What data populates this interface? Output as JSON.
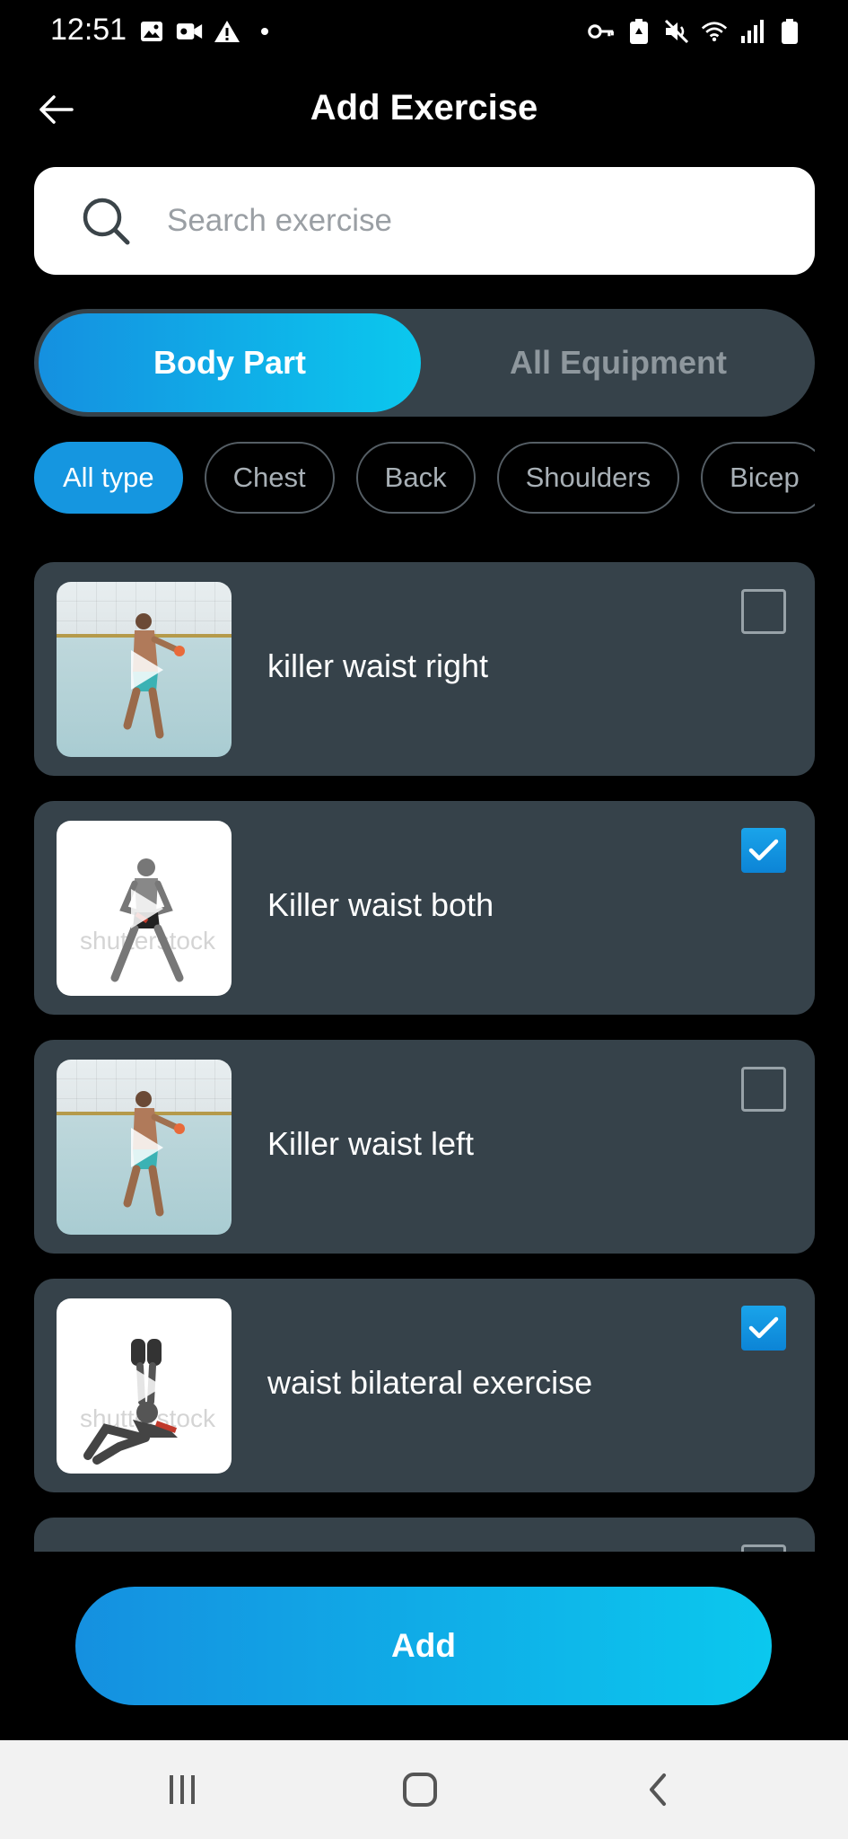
{
  "status_bar": {
    "time": "12:51",
    "left_icons": [
      "gallery-icon",
      "video-icon",
      "warning-icon",
      "dot-icon"
    ],
    "right_icons": [
      "vpn-key-icon",
      "battery-saver-icon",
      "mute-icon",
      "wifi-icon",
      "signal-icon",
      "battery-icon"
    ]
  },
  "header": {
    "title": "Add Exercise",
    "back_icon": "arrow-left-icon"
  },
  "search": {
    "placeholder": "Search exercise",
    "value": "",
    "icon": "search-icon"
  },
  "segment": {
    "options": [
      "Body Part",
      "All Equipment"
    ],
    "selected": "Body Part"
  },
  "chips": {
    "items": [
      "All type",
      "Chest",
      "Back",
      "Shoulders",
      "Bicep"
    ],
    "selected": "All type"
  },
  "exercises": [
    {
      "name": "killer waist right",
      "checked": false,
      "thumb": "pool"
    },
    {
      "name": "Killer waist both",
      "checked": true,
      "thumb": "studio"
    },
    {
      "name": "Killer waist left",
      "checked": false,
      "thumb": "pool"
    },
    {
      "name": "waist bilateral exercise",
      "checked": true,
      "thumb": "studio"
    }
  ],
  "add_button": {
    "label": "Add"
  },
  "nav_bar": {
    "icons": [
      "recent-apps-icon",
      "home-icon",
      "back-icon"
    ]
  },
  "colors": {
    "accent_start": "#1590e0",
    "accent_end": "#0bc8ee",
    "card_bg": "#36424a",
    "background": "#000000"
  }
}
